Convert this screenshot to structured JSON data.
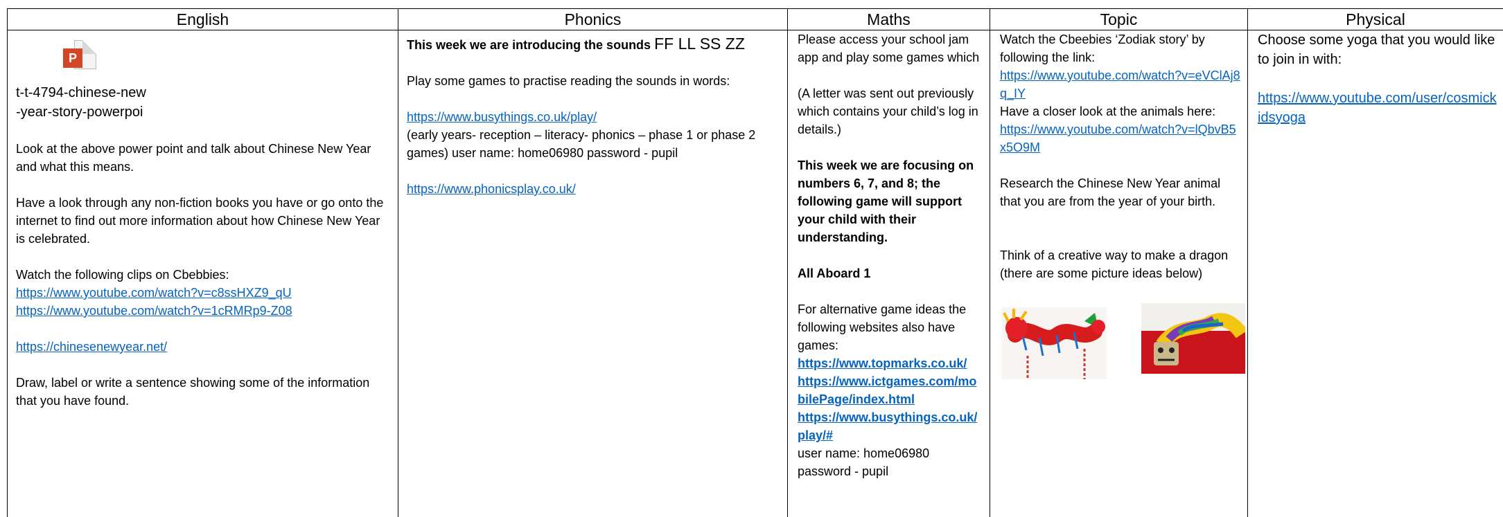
{
  "headers": {
    "english": "English",
    "phonics": "Phonics",
    "maths": "Maths",
    "topic": "Topic",
    "physical": "Physical"
  },
  "english": {
    "attachment_icon": "powerpoint-file-icon",
    "attachment_badge": "P",
    "attachment_name_line1": "t-t-4794-chinese-new",
    "attachment_name_line2": "-year-story-powerpoi",
    "p1": "Look at the above power point and talk about Chinese New Year and what this means.",
    "p2": "Have a look through any non-fiction books you have or go onto the internet to find out more information about how Chinese New Year is celebrated.",
    "p3": "Watch the following clips on Cbebbies:",
    "link1": "https://www.youtube.com/watch?v=c8ssHXZ9_qU",
    "link2": "https://www.youtube.com/watch?v=1cRMRp9-Z08",
    "link3": "https://chinesenewyear.net/",
    "p4": "Draw, label or write a sentence showing some of the information that you have found."
  },
  "phonics": {
    "intro": "This week we are introducing the sounds",
    "sounds": "FF LL SS ZZ",
    "p1": "Play some games to practise reading the sounds in words:",
    "link1": "https://www.busythings.co.uk/play/",
    "p2": "(early years- reception – literacy- phonics – phase 1 or phase 2 games) user name: home06980 password - pupil",
    "link2": "https://www.phonicsplay.co.uk/"
  },
  "maths": {
    "p1": "Please access your school jam app and play some games which",
    "p2": "(A letter was sent out previously which contains your child’s log in details.)",
    "focus": "This week we are focusing on numbers 6, 7, and 8; the following game will support your child with their understanding.",
    "game": "All Aboard 1",
    "p3": "For alternative game ideas the following websites also have games:",
    "link1": "https://www.topmarks.co.uk/",
    "link2": "https://www.ictgames.com/mobilePage/index.html",
    "link3": "https://www.busythings.co.uk/play/#",
    "login": "user name: home06980 password - pupil"
  },
  "topic": {
    "p1": "Watch the Cbeebies ‘Zodiak story’ by following the link:",
    "link1": "https://www.youtube.com/watch?v=eVClAj8q_IY",
    "p2": "Have a closer look at the animals here:",
    "link2": "https://www.youtube.com/watch?v=lQbvB5x5O9M",
    "p3": "Research the Chinese New Year animal that you are from the year of your birth.",
    "p4": "Think of a creative way to make a dragon (there are some picture ideas below)"
  },
  "physical": {
    "p1": "Choose some yoga that you would like to join in with:",
    "link1": "https://www.youtube.com/user/cosmickidsyoga"
  }
}
